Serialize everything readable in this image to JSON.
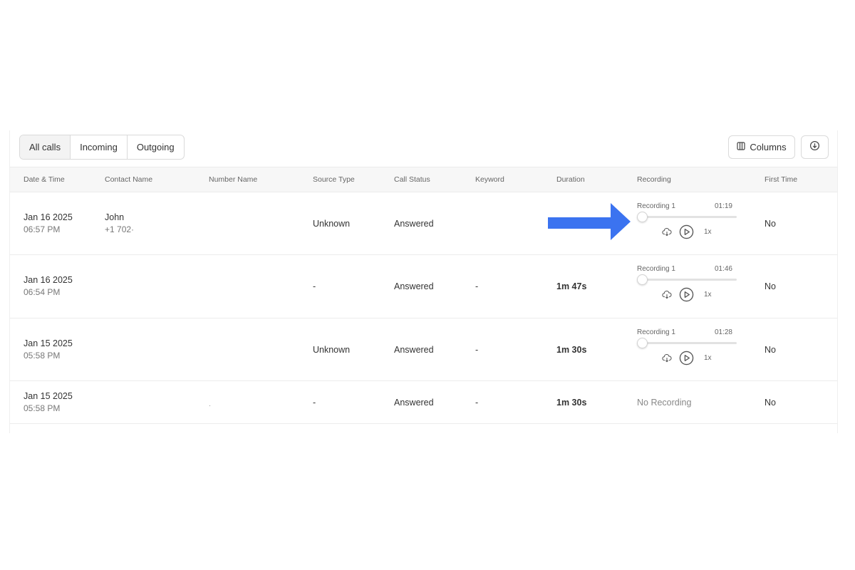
{
  "filters": {
    "tabs": [
      {
        "label": "All calls",
        "active": true
      },
      {
        "label": "Incoming",
        "active": false
      },
      {
        "label": "Outgoing",
        "active": false
      }
    ]
  },
  "toolbar": {
    "columns_label": "Columns",
    "columns_icon": "columns-icon",
    "download_icon": "download-icon"
  },
  "table": {
    "headers": [
      "Date & Time",
      "Contact Name",
      "Number Name",
      "Source Type",
      "Call Status",
      "Keyword",
      "Duration",
      "Recording",
      "First Time"
    ],
    "rows": [
      {
        "date": "Jan 16 2025",
        "time": "06:57 PM",
        "contact_name": "John",
        "contact_number": "+1 702·",
        "number_name": "",
        "source_type": "Unknown",
        "call_status": "Answered",
        "keyword": "",
        "duration": "",
        "recording": {
          "label": "Recording 1",
          "length": "01:19",
          "speed": "1x",
          "progress": 0
        },
        "first_time": "No"
      },
      {
        "date": "Jan 16 2025",
        "time": "06:54 PM",
        "contact_name": "",
        "contact_number": "",
        "number_name": "",
        "source_type": "-",
        "call_status": "Answered",
        "keyword": "-",
        "duration": "1m 47s",
        "recording": {
          "label": "Recording 1",
          "length": "01:46",
          "speed": "1x",
          "progress": 0
        },
        "first_time": "No"
      },
      {
        "date": "Jan 15 2025",
        "time": "05:58 PM",
        "contact_name": "",
        "contact_number": "",
        "number_name": "",
        "source_type": "Unknown",
        "call_status": "Answered",
        "keyword": "-",
        "duration": "1m 30s",
        "recording": {
          "label": "Recording 1",
          "length": "01:28",
          "speed": "1x",
          "progress": 0
        },
        "first_time": "No"
      },
      {
        "date": "Jan 15 2025",
        "time": "05:58 PM",
        "contact_name": "",
        "contact_number": "",
        "number_name": "·",
        "source_type": "-",
        "call_status": "Answered",
        "keyword": "-",
        "duration": "1m 30s",
        "no_recording": "No Recording",
        "first_time": "No"
      }
    ]
  },
  "annotation": {
    "arrow_color": "#3b73f0"
  },
  "colors": {
    "border": "#dadada",
    "header_bg": "#f7f7f7",
    "active_tab_bg": "#f3f3f3"
  }
}
